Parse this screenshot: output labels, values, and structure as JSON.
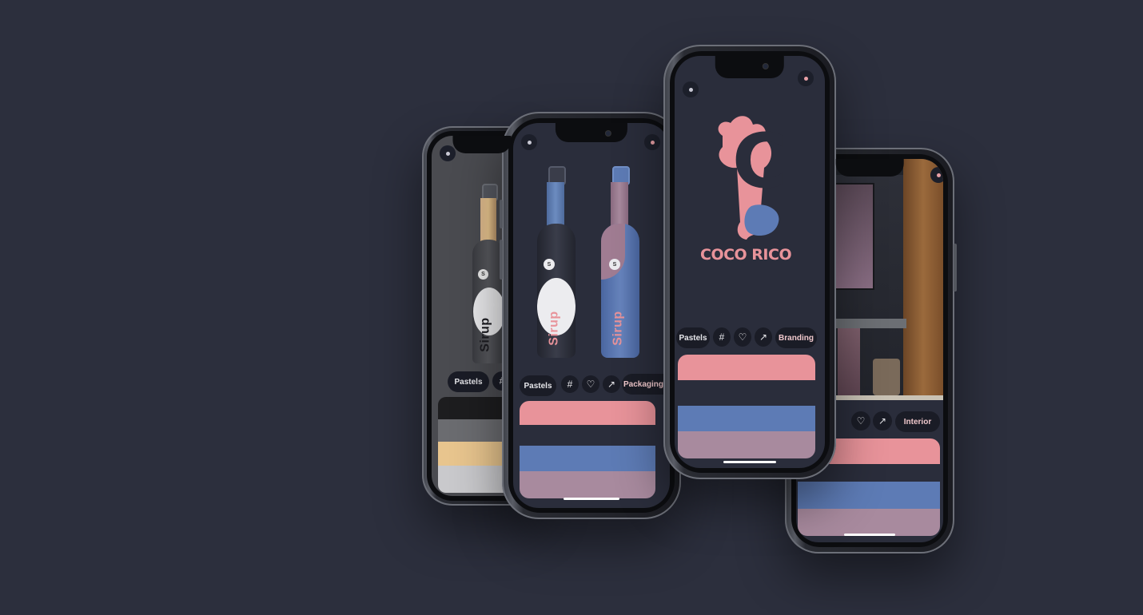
{
  "colors": {
    "background": "#2c2f3d",
    "pink": "#e8939a",
    "navy": "#2a2d3b",
    "blue": "#5d7bb5",
    "mauve": "#a88a9e",
    "black": "#1d1d1f",
    "sand": "#e8c58e",
    "gray": "#c9c9cc"
  },
  "phone1": {
    "chip_label": "Pastels",
    "hash_icon": "#",
    "bottle_text": "Sirup",
    "bottle_badge": "S",
    "palette": [
      "#1d1d1f",
      "#6b6c70",
      "#e8c58e",
      "#c9c9cc"
    ]
  },
  "phone2": {
    "chip_label": "Pastels",
    "hash_icon": "#",
    "heart_icon": "♡",
    "share_icon": "↗",
    "category_label": "Packaging",
    "bottle_text_1": "Sirup",
    "bottle_text_2": "Sirup",
    "bottle_badge": "S",
    "palette": [
      "#e8939a",
      "#2a2d3b",
      "#5d7bb5",
      "#a88a9e"
    ]
  },
  "phone3": {
    "logo_letter": "C",
    "brand_name": "COCO RICO",
    "chip_label": "Pastels",
    "hash_icon": "#",
    "heart_icon": "♡",
    "share_icon": "↗",
    "category_label": "Branding",
    "palette": [
      "#e8939a",
      "#2a2d3b",
      "#5d7bb5",
      "#a88a9e"
    ]
  },
  "phone4": {
    "hash_icon": "#",
    "heart_icon": "♡",
    "share_icon": "↗",
    "category_label": "Interior",
    "palette": [
      "#e8939a",
      "#2a2d3b",
      "#5d7bb5",
      "#a88a9e"
    ]
  }
}
